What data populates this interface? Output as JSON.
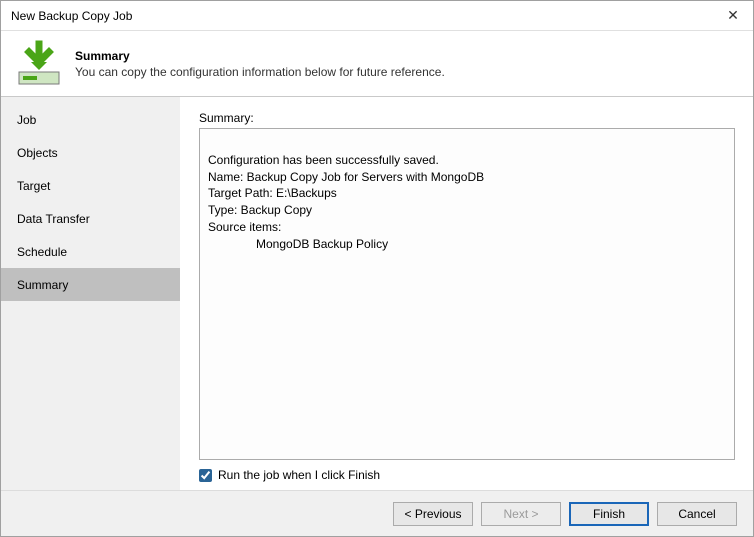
{
  "window": {
    "title": "New Backup Copy Job"
  },
  "header": {
    "title": "Summary",
    "subtitle": "You can copy the configuration information below for future reference."
  },
  "sidebar": {
    "items": [
      {
        "label": "Job"
      },
      {
        "label": "Objects"
      },
      {
        "label": "Target"
      },
      {
        "label": "Data Transfer"
      },
      {
        "label": "Schedule"
      },
      {
        "label": "Summary"
      }
    ],
    "active_index": 5
  },
  "main": {
    "summary_label": "Summary:",
    "summary_lines": {
      "line1": "Configuration has been successfully saved.",
      "line2": "Name: Backup Copy Job for Servers with MongoDB",
      "line3": "Target Path: E:\\Backups",
      "line4": "Type: Backup Copy",
      "line5": "Source items:",
      "line6": "MongoDB Backup Policy"
    },
    "checkbox_label": "Run the job when I click Finish",
    "checkbox_checked": true
  },
  "buttons": {
    "previous": "< Previous",
    "next": "Next >",
    "finish": "Finish",
    "cancel": "Cancel"
  },
  "icons": {
    "close": "✕"
  },
  "colors": {
    "accent_blue": "#1a66b8",
    "arrow_green": "#4aa517",
    "sidebar_bg": "#f0f0f0",
    "active_nav": "#bfbfbf"
  }
}
